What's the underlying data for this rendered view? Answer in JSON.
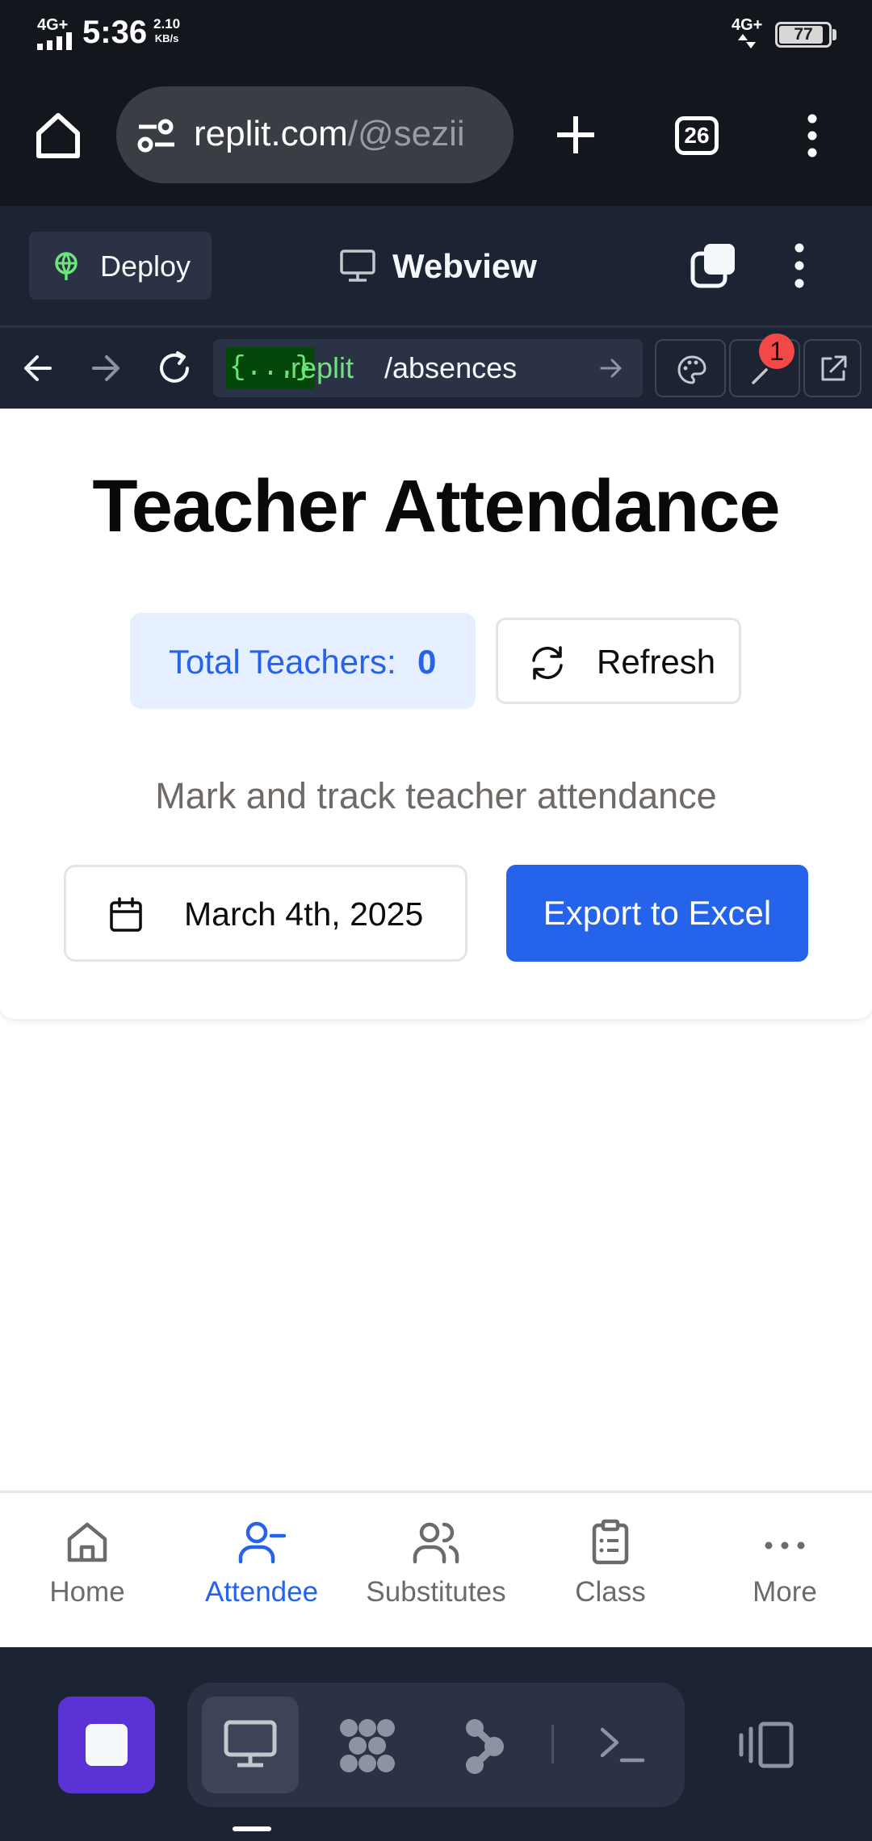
{
  "status_bar": {
    "network_left": "4G+",
    "time": "5:36",
    "speed_value": "2.10",
    "speed_unit": "KB/s",
    "network_right": "4G+",
    "battery": "77"
  },
  "browser": {
    "url_main": "replit.com",
    "url_dim": "/@sezii",
    "tab_count": "26"
  },
  "replit_header": {
    "deploy_label": "Deploy",
    "webview_label": "Webview"
  },
  "webview_nav": {
    "badge": "{...}",
    "host": ".replit",
    "path": "/absences",
    "notification_count": "1"
  },
  "page": {
    "title": "Teacher Attendance",
    "total_label": "Total Teachers:",
    "total_value": "0",
    "refresh_label": "Refresh",
    "subtitle": "Mark and track teacher attendance",
    "date_value": "March 4th, 2025",
    "export_label": "Export to Excel"
  },
  "bottom_nav": {
    "items": [
      {
        "label": "Home",
        "icon": "home-icon",
        "active": false
      },
      {
        "label": "Attendee",
        "icon": "user-minus-icon",
        "active": true
      },
      {
        "label": "Substitutes",
        "icon": "users-icon",
        "active": false
      },
      {
        "label": "Class",
        "icon": "clipboard-icon",
        "active": false
      },
      {
        "label": "More",
        "icon": "more-horizontal-icon",
        "active": false
      }
    ]
  },
  "colors": {
    "primary": "#2563eb",
    "replit_bg": "#1c2333",
    "replit_green": "#6be579",
    "stop_purple": "#5b32d6"
  }
}
